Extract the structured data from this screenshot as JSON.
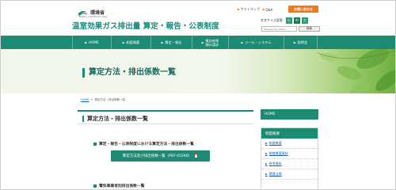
{
  "header": {
    "ministry": "環境省",
    "ministry_en": "Ministry of the Environment",
    "site_title": "温室効果ガス排出量 算定・報告・公表制度",
    "util_links": [
      {
        "label": "サイトマップ"
      },
      {
        "label": "Q&A"
      }
    ],
    "inquiry_label": "お問い合わせ",
    "fontsize_label": "文字サイズ変更",
    "fontsize_buttons": [
      "小",
      "中",
      "大"
    ],
    "search_placeholder": "Powered by Yahoo!",
    "search_button": "検索"
  },
  "nav": {
    "items": [
      {
        "label": "HOME"
      },
      {
        "label": "制度概要"
      },
      {
        "label": "算定・報告"
      },
      {
        "label_line1": "集計結果",
        "label_line2": "開示請求"
      },
      {
        "label": "ツール・システム"
      },
      {
        "label": "説明会"
      }
    ]
  },
  "banner": {
    "title": "算定方法・排出係数一覧"
  },
  "breadcrumb": {
    "home": "HOME",
    "sep": ">",
    "parent": "算定方法・排出係数一覧"
  },
  "main": {
    "heading": "算定方法・排出係数一覧",
    "section1_title": "算定・報告・公表制度における算定方法・排出係数一覧",
    "download_label": "算定方法及び排出係数一覧（PDF:452KB）",
    "pdf_icon": "PDF",
    "section2_title": "電気事業者別排出係数一覧"
  },
  "sidebar": {
    "home": "HOME",
    "section_title": "制度概要",
    "items": [
      {
        "label": "制度概要"
      },
      {
        "label": "制度概要資料"
      },
      {
        "label": "参考資料"
      },
      {
        "label": "関連法規"
      }
    ]
  },
  "colors": {
    "primary": "#1d8a74",
    "accent": "#f07a1a",
    "link": "#1d5fa8"
  }
}
